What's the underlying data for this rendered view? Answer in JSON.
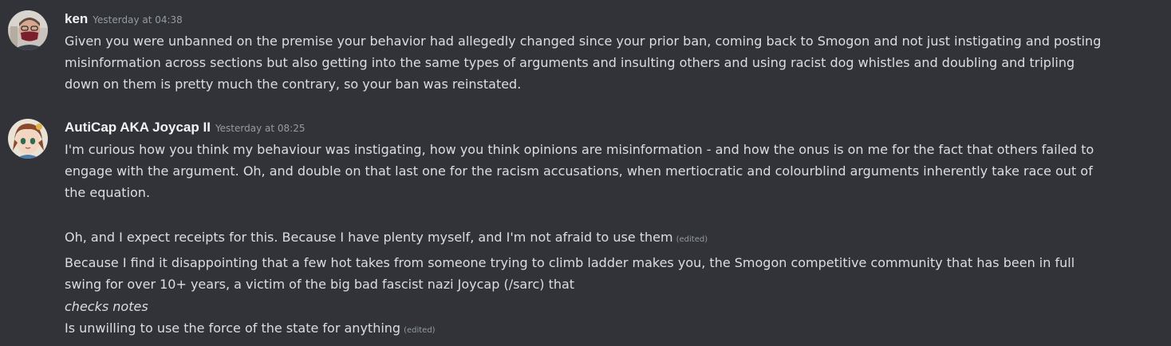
{
  "messages": [
    {
      "author": "ken",
      "timestamp": "Yesterday at 04:38",
      "avatar_icon": "user-avatar-man-glasses-mask",
      "lines": [
        "Given you were unbanned on the premise your behavior had allegedly changed since your prior ban, coming back to Smogon and not just instigating and posting",
        "misinformation across sections but also getting into the same types of arguments and insulting others and using racist dog whistles and doubling and tripling",
        "down on them is pretty much the contrary, so your ban was reinstated."
      ]
    },
    {
      "author": "AutiCap AKA Joycap II",
      "timestamp": "Yesterday at 08:25",
      "avatar_icon": "user-avatar-anime-girl",
      "lines": [
        "I'm curious how you think my behaviour was instigating, how you think opinions are misinformation - and how the onus is on me for the fact that others failed to",
        "engage with the argument. Oh, and double on that last one for the racism accusations, when mertiocratic and colourblind arguments inherently take race out of",
        "the equation."
      ],
      "line_after_gap": "Oh, and I expect receipts for this. Because I have plenty myself, and I'm not afraid to use them",
      "edited_label": "(edited)",
      "followup_lines": [
        "Because I find it disappointing that a few hot takes from someone trying to climb ladder makes you, the Smogon competitive community that has been in full",
        "swing for over 10+ years, a victim of the big bad fascist nazi Joycap (/sarc) that"
      ],
      "italic_line": "checks notes",
      "final_line": "Is unwilling to use the force of the state for anything",
      "final_edited_label": "(edited)"
    }
  ]
}
